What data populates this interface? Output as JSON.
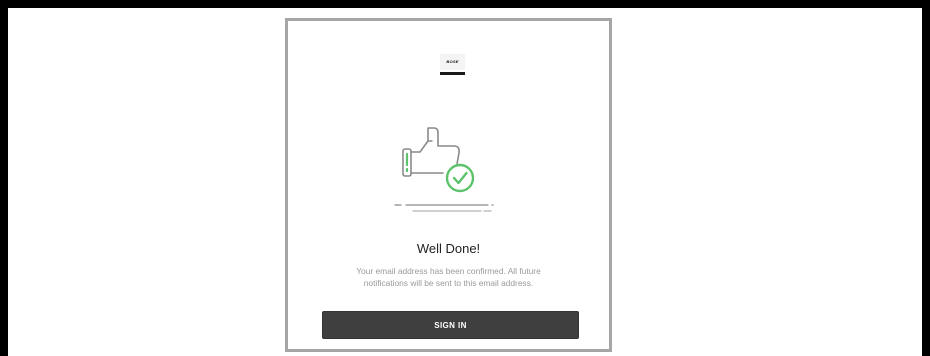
{
  "logo": {
    "wordmark": "BOSE",
    "icon": "bose-logo"
  },
  "illustration": {
    "icon": "thumbs-up-check-icon",
    "check_color": "#5cc36b",
    "outline_color": "#8a8a8a"
  },
  "confirmation": {
    "title": "Well Done!",
    "message": "Your email address has been confirmed. All future notifications will be sent to this email address."
  },
  "actions": {
    "sign_in_label": "SIGN IN"
  },
  "colors": {
    "button_bg": "#3f3f3f",
    "card_border": "#a6a6a6",
    "accent_green": "#5cc36b"
  }
}
